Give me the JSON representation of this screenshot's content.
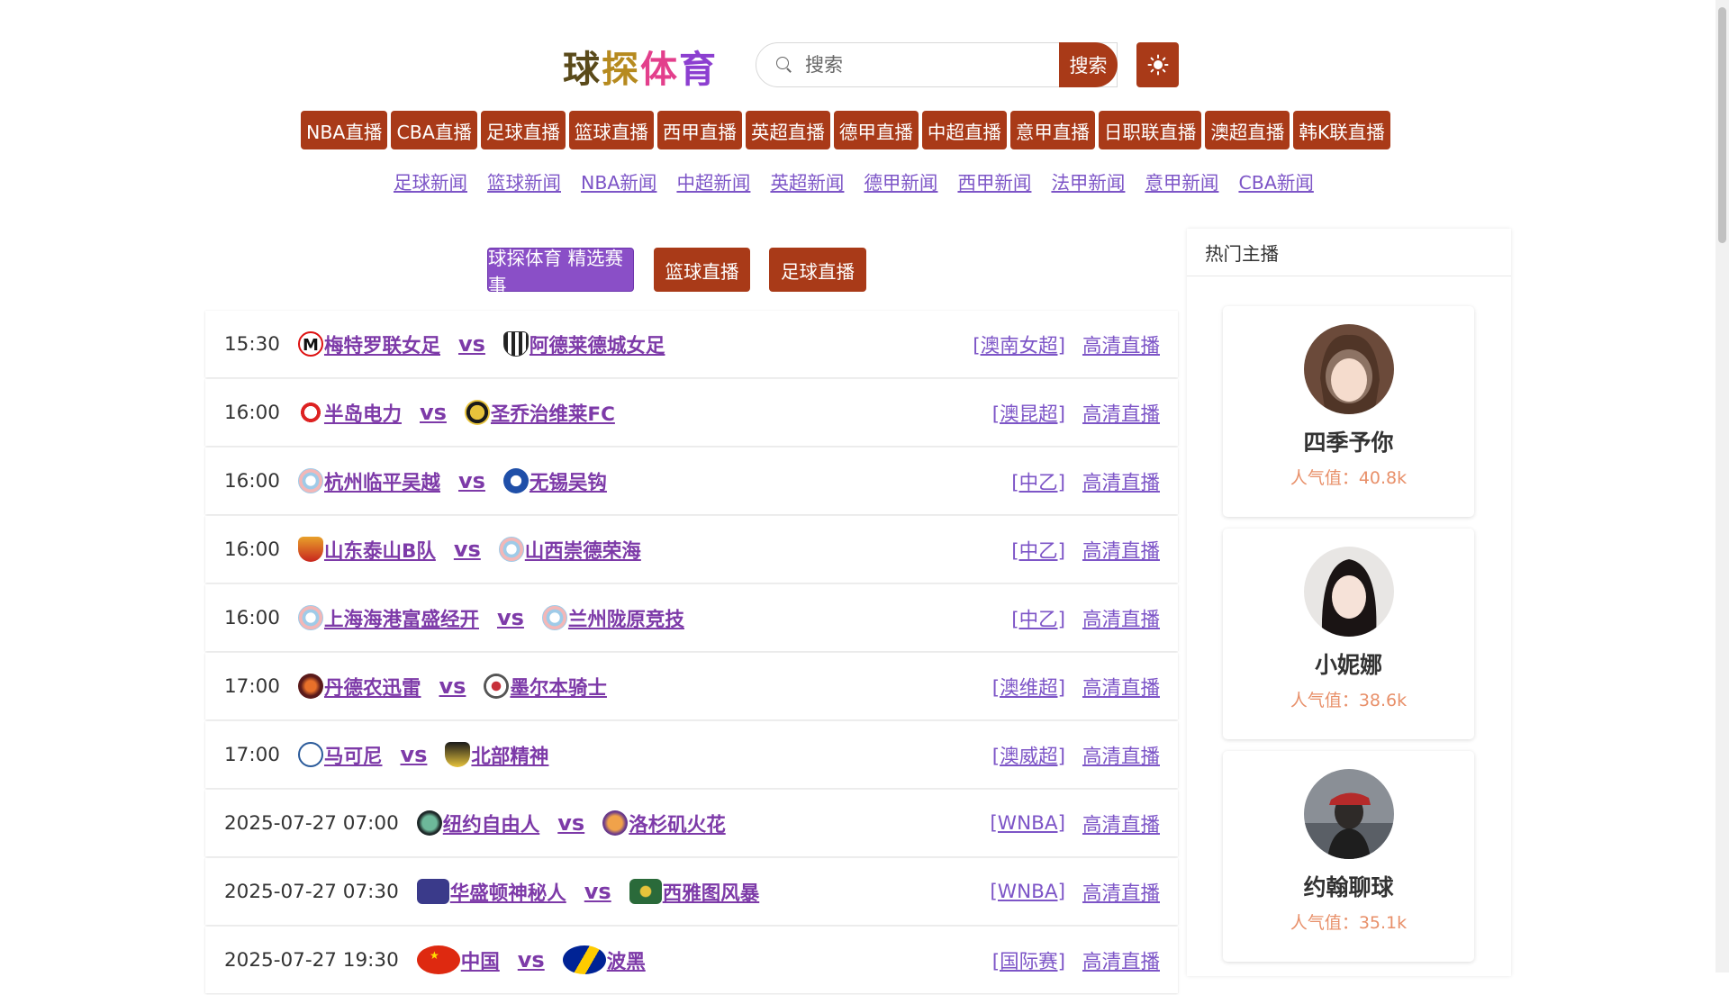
{
  "header": {
    "logo_text": "球探体育",
    "search_placeholder": "搜索",
    "search_button": "搜索",
    "theme_icon": "sun-icon"
  },
  "live_nav": [
    "NBA直播",
    "CBA直播",
    "足球直播",
    "篮球直播",
    "西甲直播",
    "英超直播",
    "德甲直播",
    "中超直播",
    "意甲直播",
    "日职联直播",
    "澳超直播",
    "韩K联直播"
  ],
  "news_nav": [
    "足球新闻",
    "篮球新闻",
    "NBA新闻",
    "中超新闻",
    "英超新闻",
    "德甲新闻",
    "西甲新闻",
    "法甲新闻",
    "意甲新闻",
    "CBA新闻"
  ],
  "filters": {
    "featured": "球探体育 精选赛事",
    "basketball": "篮球直播",
    "football": "足球直播"
  },
  "matches": [
    {
      "time": "15:30",
      "home": "梅特罗联女足",
      "away": "阿德莱德城女足",
      "league": "[澳南女超]",
      "watch": "高清直播"
    },
    {
      "time": "16:00",
      "home": "半岛电力",
      "away": "圣乔治维莱FC",
      "league": "[澳昆超]",
      "watch": "高清直播"
    },
    {
      "time": "16:00",
      "home": "杭州临平吴越",
      "away": "无锡吴钩",
      "league": "[中乙]",
      "watch": "高清直播"
    },
    {
      "time": "16:00",
      "home": "山东泰山B队",
      "away": "山西崇德荣海",
      "league": "[中乙]",
      "watch": "高清直播"
    },
    {
      "time": "16:00",
      "home": "上海海港富盛经开",
      "away": "兰州陇原竞技",
      "league": "[中乙]",
      "watch": "高清直播"
    },
    {
      "time": "17:00",
      "home": "丹德农迅雷",
      "away": "墨尔本骑士",
      "league": "[澳维超]",
      "watch": "高清直播"
    },
    {
      "time": "17:00",
      "home": "马可尼",
      "away": "北部精神",
      "league": "[澳威超]",
      "watch": "高清直播"
    },
    {
      "time": "2025-07-27 07:00",
      "home": "纽约自由人",
      "away": "洛杉矶火花",
      "league": "[WNBA]",
      "watch": "高清直播"
    },
    {
      "time": "2025-07-27 07:30",
      "home": "华盛顿神秘人",
      "away": "西雅图风暴",
      "league": "[WNBA]",
      "watch": "高清直播"
    },
    {
      "time": "2025-07-27 19:30",
      "home": "中国",
      "away": "波黑",
      "league": "[国际赛]",
      "watch": "高清直播"
    }
  ],
  "vs_label": "vs",
  "sidebar": {
    "title": "热门主播",
    "anchors": [
      {
        "name": "四季予你",
        "popularity": "人气值：40.8k"
      },
      {
        "name": "小妮娜",
        "popularity": "人气值：38.6k"
      },
      {
        "name": "约翰聊球",
        "popularity": "人气值：35.1k"
      }
    ]
  },
  "colors": {
    "accent": "#a93a18",
    "featured": "#8a4fc7",
    "link": "#7d55c7",
    "team": "#7d3aa8",
    "popularity": "#e8906a"
  }
}
